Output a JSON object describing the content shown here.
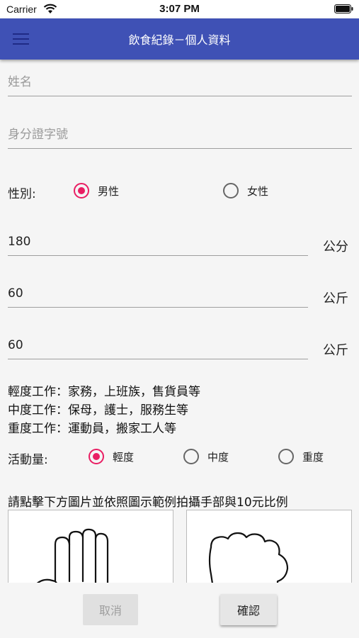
{
  "status_bar": {
    "carrier": "Carrier",
    "time": "3:07 PM"
  },
  "app_bar": {
    "title": "飲食紀錄－個人資料"
  },
  "form": {
    "name_placeholder": "姓名",
    "id_placeholder": "身分證字號",
    "gender": {
      "label": "性別:",
      "options": [
        "男性",
        "女性"
      ],
      "selected": "男性"
    },
    "height": {
      "value": "180",
      "unit": "公分"
    },
    "weight": {
      "value": "60",
      "unit": "公斤"
    },
    "target_weight": {
      "value": "60",
      "unit": "公斤"
    },
    "activity_info": [
      "輕度工作：家務，上班族，售貨員等",
      "中度工作：保母，護士，服務生等",
      "重度工作：運動員，搬家工人等"
    ],
    "activity": {
      "label": "活動量:",
      "options": [
        "輕度",
        "中度",
        "重度"
      ],
      "selected": "輕度"
    },
    "instruction": "請點擊下方圖片並依照圖示範例拍攝手部與10元比例"
  },
  "photos": [
    {
      "icon": "open-hand-icon"
    },
    {
      "icon": "fist-icon"
    }
  ],
  "buttons": {
    "cancel": "取消",
    "confirm": "確認"
  },
  "colors": {
    "app_bar": "#3f51b5",
    "radio_accent": "#e91e63"
  }
}
